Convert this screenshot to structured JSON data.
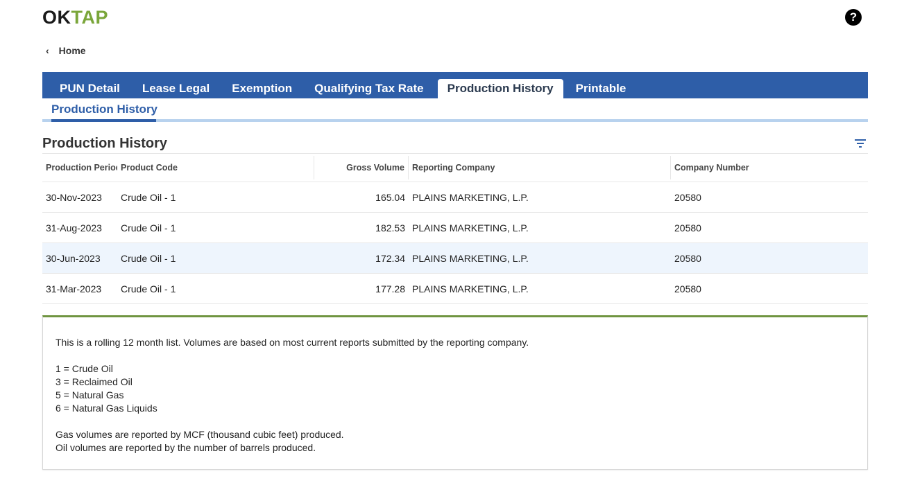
{
  "header": {
    "logo_ok": "OK",
    "logo_tap": "TAP",
    "help_label": "?"
  },
  "breadcrumb": {
    "back_glyph": "‹",
    "label": "Home"
  },
  "tabs": [
    {
      "label": "PUN Detail",
      "active": false
    },
    {
      "label": "Lease Legal",
      "active": false
    },
    {
      "label": "Exemption",
      "active": false
    },
    {
      "label": "Qualifying Tax Rate",
      "active": false
    },
    {
      "label": "Production History",
      "active": true
    },
    {
      "label": "Printable",
      "active": false
    }
  ],
  "subtab": {
    "label": "Production History"
  },
  "section": {
    "title": "Production History",
    "filter_icon": "filter-icon"
  },
  "table": {
    "columns": [
      "Production Period",
      "Product Code",
      "Gross Volume",
      "Reporting Company",
      "Company Number"
    ],
    "rows": [
      {
        "period": "30-Nov-2023",
        "product": "Crude Oil - 1",
        "volume": "165.04",
        "company": "PLAINS MARKETING, L.P.",
        "number": "20580"
      },
      {
        "period": "31-Aug-2023",
        "product": "Crude Oil - 1",
        "volume": "182.53",
        "company": "PLAINS MARKETING, L.P.",
        "number": "20580"
      },
      {
        "period": "30-Jun-2023",
        "product": "Crude Oil - 1",
        "volume": "172.34",
        "company": "PLAINS MARKETING, L.P.",
        "number": "20580"
      },
      {
        "period": "31-Mar-2023",
        "product": "Crude Oil - 1",
        "volume": "177.28",
        "company": "PLAINS MARKETING, L.P.",
        "number": "20580"
      }
    ]
  },
  "notes": {
    "intro": "This is a rolling 12 month list. Volumes are based on most current reports submitted by the reporting company.",
    "codes": [
      "1 = Crude Oil",
      "3 = Reclaimed Oil",
      "5 = Natural Gas",
      "6 = Natural Gas Liquids"
    ],
    "gas": "Gas volumes are reported by MCF (thousand cubic feet) produced.",
    "oil": "Oil volumes are reported by the number of barrels produced."
  },
  "colors": {
    "tab_bar": "#2e5ea8",
    "logo_green": "#7aa63a",
    "notes_accent": "#6f9440",
    "row_highlight": "#eef5fd"
  }
}
